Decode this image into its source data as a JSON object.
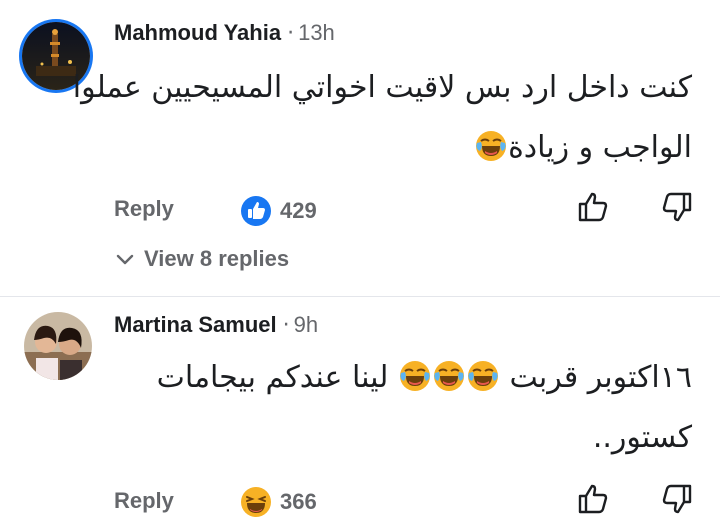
{
  "comments": [
    {
      "author": "Mahmoud Yahia",
      "separator": "·",
      "time": "13h",
      "line1": "كنت داخل ارد بس لاقيت اخواتي المسيحيين عملوا",
      "line2": "الواجب و زيادة",
      "line2_emoji": "laughing-tears-emoji",
      "reply_label": "Reply",
      "reaction_icon": "like-reaction-icon",
      "reaction_count": "429",
      "view_replies_label": "View 8 replies"
    },
    {
      "author": "Martina Samuel",
      "separator": "·",
      "time": "9h",
      "line1_text_a": "١٦اكتوبر قربت",
      "line1_emojis": [
        "laughing-tears-emoji",
        "laughing-tears-emoji",
        "laughing-tears-emoji"
      ],
      "line1_text_b": "لينا عندكم بيجامات",
      "line2": "كستور..",
      "reply_label": "Reply",
      "reaction_icon": "haha-reaction-icon",
      "reaction_count": "366"
    }
  ],
  "colors": {
    "accent": "#1877f2",
    "text_primary": "#1c1e21",
    "text_secondary": "#65676b",
    "emoji_face": "#f7b125"
  }
}
